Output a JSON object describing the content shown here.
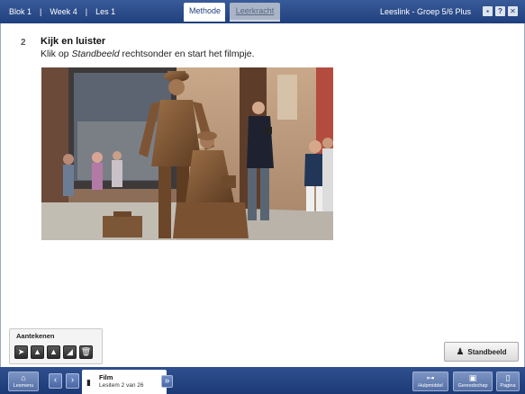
{
  "topbar": {
    "crumbs": [
      "Blok 1",
      "Week 4",
      "Les 1"
    ],
    "tabs": [
      {
        "label": "Methode",
        "active": true
      },
      {
        "label": "Leerkracht",
        "active": false
      }
    ],
    "title": "Leeslink - Groep 5/6 Plus",
    "buttons": [
      {
        "icon": "save-icon",
        "glyph": "▪"
      },
      {
        "icon": "help-icon",
        "glyph": "?"
      },
      {
        "icon": "close-icon",
        "glyph": "✕"
      }
    ]
  },
  "step": {
    "number": "2",
    "title": "Kijk en luister",
    "instruction_prefix": "Klik op ",
    "instruction_emphasis": "Standbeeld",
    "instruction_suffix": " rechtsonder en start het filmpje."
  },
  "notes": {
    "title": "Aantekenen",
    "tools": [
      {
        "icon": "pointer-icon",
        "glyph": "➤"
      },
      {
        "icon": "pen-icon",
        "glyph": "▲"
      },
      {
        "icon": "marker-icon",
        "glyph": "▲"
      },
      {
        "icon": "eraser-icon",
        "glyph": "◢"
      },
      {
        "icon": "trash-icon",
        "glyph": "🗑"
      }
    ]
  },
  "standbeeld_button": {
    "label": "Standbeeld",
    "icon": "people-icon"
  },
  "bottombar": {
    "lesmenu": {
      "label": "Lesmenu",
      "icon": "home-icon",
      "glyph": "⌂"
    },
    "prev": {
      "glyph": "‹"
    },
    "next": {
      "glyph": "›"
    },
    "lesitem": {
      "name": "Film",
      "count": "Lesitem 2 van 26"
    },
    "skip": {
      "glyph": "»"
    },
    "hulpmiddel": {
      "label": "Hulpmiddel",
      "icon": "tool-icon",
      "glyph": "⊶"
    },
    "gereedschap": {
      "label": "Gereedschap",
      "icon": "toolbox-icon",
      "glyph": "▣"
    },
    "pagina": {
      "label": "Pagina",
      "icon": "page-icon",
      "glyph": "▯"
    }
  },
  "colors": {
    "bar": "#1f3f7d",
    "button": "#5670a7"
  }
}
